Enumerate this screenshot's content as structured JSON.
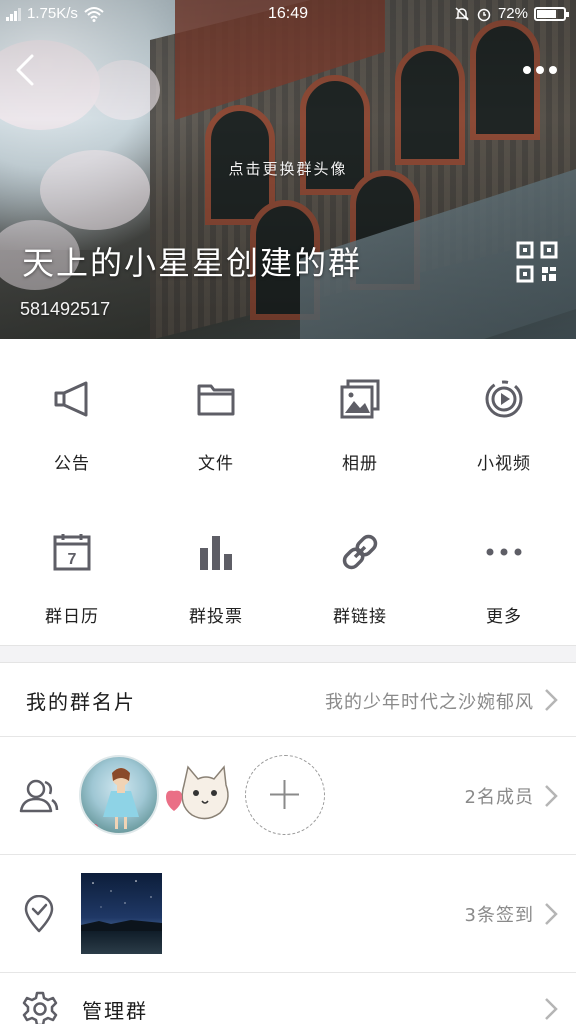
{
  "status_bar": {
    "speed": "1.75K/s",
    "time": "16:49",
    "battery": "72%",
    "battery_level": 0.72
  },
  "header": {
    "change_avatar_hint": "点击更换群头像",
    "group_name": "天上的小星星创建的群",
    "group_id": "581492517",
    "icons": [
      "back-arrow-icon",
      "more-dots-icon",
      "qr-code-icon"
    ]
  },
  "functions": [
    {
      "label": "公告",
      "icon": "megaphone-icon"
    },
    {
      "label": "文件",
      "icon": "folder-icon"
    },
    {
      "label": "相册",
      "icon": "album-icon"
    },
    {
      "label": "小视频",
      "icon": "video-icon"
    },
    {
      "label": "群日历",
      "icon": "calendar-icon",
      "day": "7"
    },
    {
      "label": "群投票",
      "icon": "bar-chart-icon"
    },
    {
      "label": "群链接",
      "icon": "link-icon"
    },
    {
      "label": "更多",
      "icon": "more-icon"
    }
  ],
  "card": {
    "title": "我的群名片",
    "value": "我的少年时代之沙婉郁风"
  },
  "members": {
    "count": "2名成员",
    "icon": "members-icon"
  },
  "checkin": {
    "count": "3条签到",
    "icon": "location-check-icon"
  },
  "manage": {
    "title": "管理群",
    "icon": "gear-icon"
  },
  "colors": {
    "icon_gray": "#5e5e66",
    "separator": "#f3f3f5",
    "secondary_text": "#8a8a8a"
  }
}
